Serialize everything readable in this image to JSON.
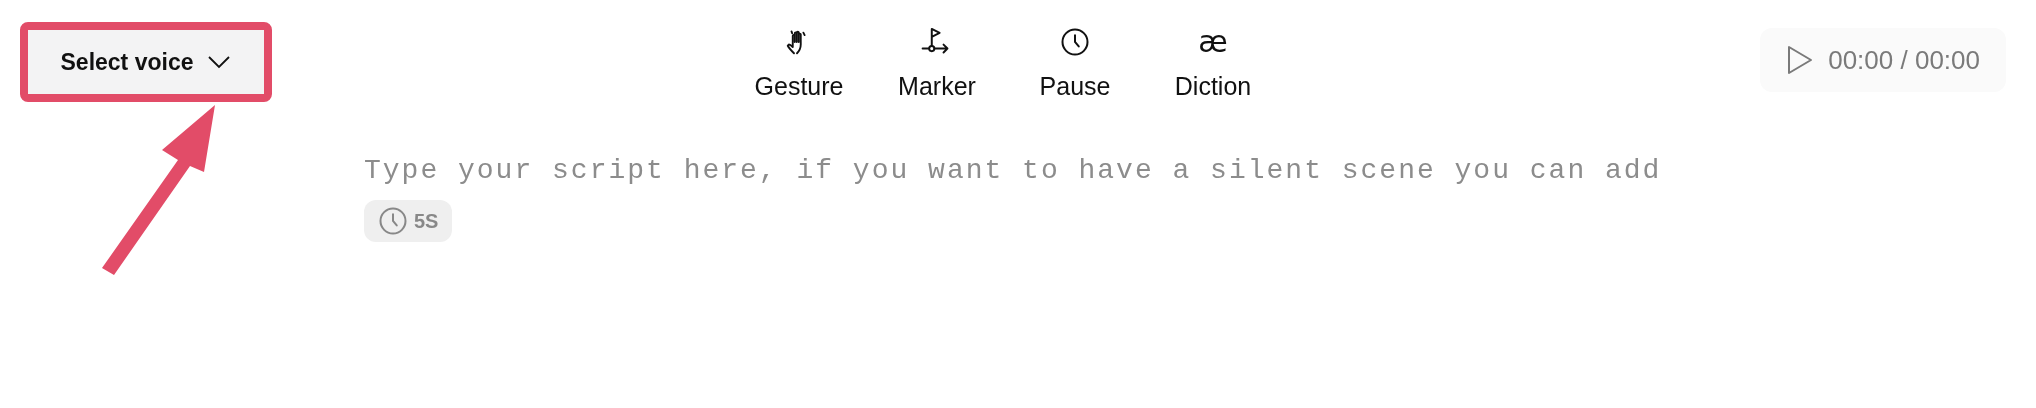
{
  "voice_select": {
    "label": "Select voice",
    "highlighted": true
  },
  "toolbar": [
    {
      "kind": "gesture",
      "label": "Gesture"
    },
    {
      "kind": "marker",
      "label": "Marker"
    },
    {
      "kind": "pause",
      "label": "Pause"
    },
    {
      "kind": "diction",
      "label": "Diction",
      "glyph": "æ"
    }
  ],
  "player": {
    "time": "00:00 / 00:00"
  },
  "editor": {
    "placeholder": "Type your script here, if you want to have a silent scene you can add",
    "chip": "5S"
  }
}
